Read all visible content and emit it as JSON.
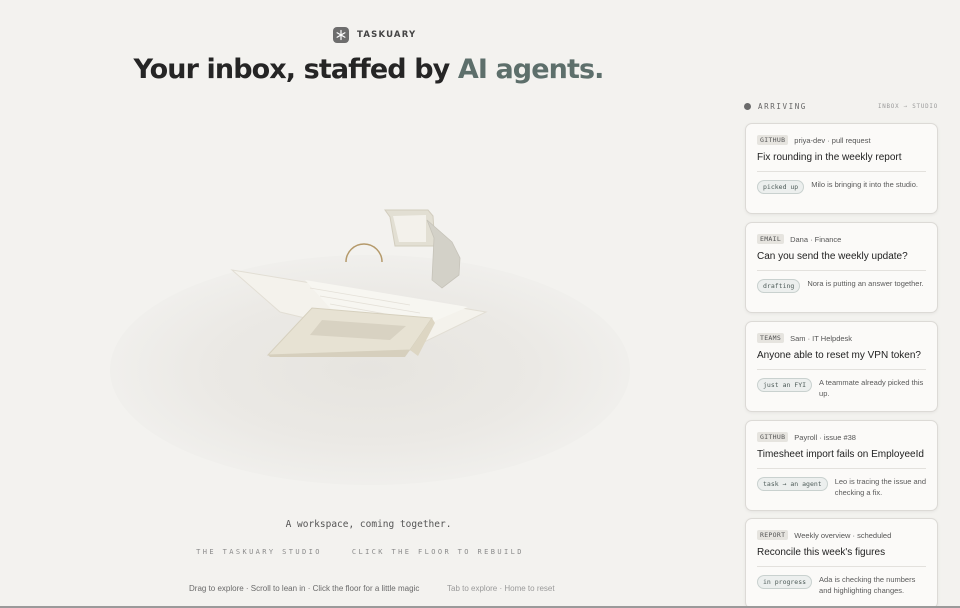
{
  "brand": {
    "name": "TASKUARY",
    "logo_icon": "snowflake-icon"
  },
  "headline": {
    "lead": "Your inbox, staffed by ",
    "accent": "AI agents."
  },
  "scene": {
    "tagline": "A workspace, coming together.",
    "studio_label": "THE TASKUARY STUDIO",
    "rebuild_label": "CLICK THE FLOOR TO REBUILD",
    "hint_primary": "Drag to explore · Scroll to lean in · Click the floor for a little magic",
    "hint_keys": "Tab to explore · Home to reset"
  },
  "feed": {
    "label": "ARRIVING",
    "route": "INBOX → STUDIO",
    "cards": [
      {
        "source": "GITHUB",
        "meta": "priya-dev · pull request",
        "title": "Fix rounding in the weekly report",
        "status": "picked up",
        "note": "Milo is bringing it into the studio."
      },
      {
        "source": "EMAIL",
        "meta": "Dana · Finance",
        "title": "Can you send the weekly update?",
        "status": "drafting",
        "note": "Nora is putting an answer together."
      },
      {
        "source": "TEAMS",
        "meta": "Sam · IT Helpdesk",
        "title": "Anyone able to reset my VPN token?",
        "status": "just an FYI",
        "note": "A teammate already picked this up."
      },
      {
        "source": "GITHUB",
        "meta": "Payroll · issue #38",
        "title": "Timesheet import fails on EmployeeId",
        "status": "task → an agent",
        "note": "Leo is tracing the issue and checking a fix."
      },
      {
        "source": "REPORT",
        "meta": "Weekly overview · scheduled",
        "title": "Reconcile this week's figures",
        "status": "in progress",
        "note": "Ada is checking the numbers and highlighting changes."
      }
    ]
  },
  "colors": {
    "background": "#f3f2ef",
    "accent": "#5d6f6b",
    "card": "#fbfaf8"
  }
}
